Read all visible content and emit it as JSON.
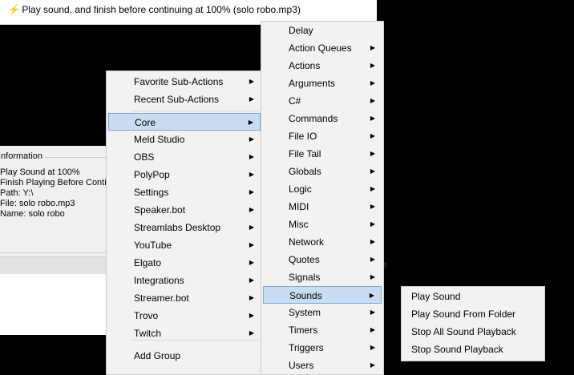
{
  "top_list": {
    "row_text": "Play sound, and finish before continuing at 100% (solo robo.mp3)"
  },
  "info_panel": {
    "title": "Information",
    "lines": [
      "Play Sound at 100%",
      "Finish Playing Before Continu",
      "Path: Y:\\",
      "File: solo robo.mp3",
      "Name: solo robo"
    ]
  },
  "menu_main": {
    "items": [
      {
        "label": "Favorite Sub-Actions",
        "submenu": true
      },
      {
        "label": "Recent Sub-Actions",
        "submenu": true
      },
      {
        "label": "Core",
        "submenu": true,
        "selected": true
      },
      {
        "label": "Meld Studio",
        "submenu": true
      },
      {
        "label": "OBS",
        "submenu": true
      },
      {
        "label": "PolyPop",
        "submenu": true
      },
      {
        "label": "Settings",
        "submenu": true
      },
      {
        "label": "Speaker.bot",
        "submenu": true
      },
      {
        "label": "Streamlabs Desktop",
        "submenu": true
      },
      {
        "label": "YouTube",
        "submenu": true
      },
      {
        "label": "Elgato",
        "submenu": true
      },
      {
        "label": "Integrations",
        "submenu": true
      },
      {
        "label": "Streamer.bot",
        "submenu": true
      },
      {
        "label": "Trovo",
        "submenu": true
      },
      {
        "label": "Twitch",
        "submenu": true
      },
      {
        "label": "Add Group",
        "submenu": false
      }
    ]
  },
  "menu_core": {
    "items": [
      {
        "label": "Delay",
        "submenu": false
      },
      {
        "label": "Action Queues",
        "submenu": true
      },
      {
        "label": "Actions",
        "submenu": true
      },
      {
        "label": "Arguments",
        "submenu": true
      },
      {
        "label": "C#",
        "submenu": true
      },
      {
        "label": "Commands",
        "submenu": true
      },
      {
        "label": "File IO",
        "submenu": true
      },
      {
        "label": "File Tail",
        "submenu": true
      },
      {
        "label": "Globals",
        "submenu": true
      },
      {
        "label": "Logic",
        "submenu": true
      },
      {
        "label": "MIDI",
        "submenu": true
      },
      {
        "label": "Misc",
        "submenu": true
      },
      {
        "label": "Network",
        "submenu": true
      },
      {
        "label": "Quotes",
        "submenu": true
      },
      {
        "label": "Signals",
        "submenu": true
      },
      {
        "label": "Sounds",
        "submenu": true,
        "selected": true
      },
      {
        "label": "System",
        "submenu": true
      },
      {
        "label": "Timers",
        "submenu": true
      },
      {
        "label": "Triggers",
        "submenu": true
      },
      {
        "label": "Users",
        "submenu": true
      }
    ]
  },
  "menu_sounds": {
    "items": [
      {
        "label": "Play Sound"
      },
      {
        "label": "Play Sound From Folder"
      },
      {
        "label": "Stop All Sound Playback"
      },
      {
        "label": "Stop Sound Playback"
      }
    ]
  },
  "icons": {
    "submenu_arrow": "▶",
    "row_icon": "lightning-icon"
  },
  "colors": {
    "menu_bg": "#f2f2f2",
    "selected_bg": "#c8ddf2",
    "selected_border": "#7aa7d6",
    "lightning": "#f5c400"
  }
}
